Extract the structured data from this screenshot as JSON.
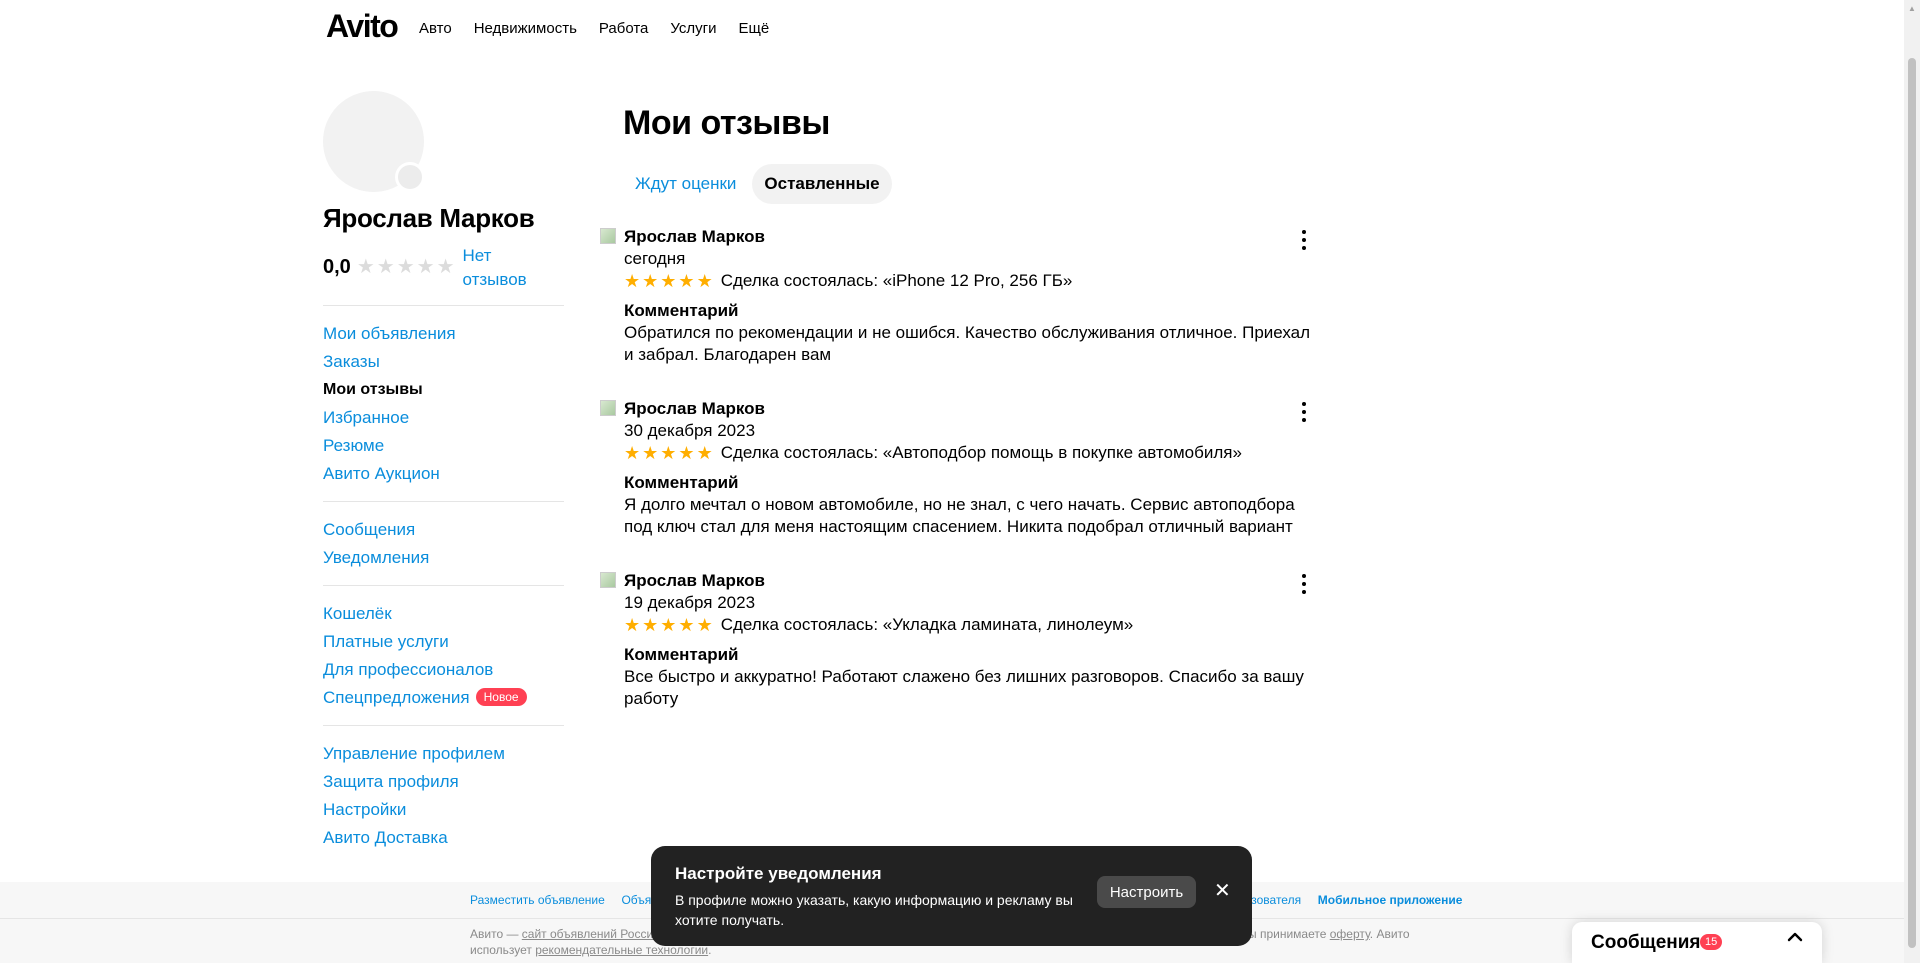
{
  "header": {
    "logo": "Avito",
    "nav": [
      "Авто",
      "Недвижимость",
      "Работа",
      "Услуги",
      "Ещё"
    ]
  },
  "profile": {
    "name": "Ярослав Марков",
    "rating": "0,0",
    "no_reviews_label": "Нет отзывов"
  },
  "sidebar": {
    "groups": [
      [
        {
          "label": "Мои объявления"
        },
        {
          "label": "Заказы"
        },
        {
          "label": "Мои отзывы",
          "active": true
        },
        {
          "label": "Избранное"
        },
        {
          "label": "Резюме"
        },
        {
          "label": "Авито Аукцион"
        }
      ],
      [
        {
          "label": "Сообщения"
        },
        {
          "label": "Уведомления"
        }
      ],
      [
        {
          "label": "Кошелёк"
        },
        {
          "label": "Платные услуги"
        },
        {
          "label": "Для профессионалов"
        },
        {
          "label": "Спецпредложения",
          "badge": "Новое"
        }
      ],
      [
        {
          "label": "Управление профилем"
        },
        {
          "label": "Защита профиля"
        },
        {
          "label": "Настройки"
        },
        {
          "label": "Авито Доставка"
        }
      ]
    ]
  },
  "main": {
    "title": "Мои отзывы",
    "tabs": [
      {
        "label": "Ждут оценки",
        "active": false
      },
      {
        "label": "Оставленные",
        "active": true
      }
    ],
    "comment_label": "Комментарий",
    "reviews": [
      {
        "author": "Ярослав Марков",
        "date": "сегодня",
        "stars": 5,
        "deal": "Сделка состоялась: «iPhone 12 Pro, 256 ГБ»",
        "comment": "Обратился по рекомендации и не ошибся. Качество обслуживания отличное. Приехал и забрал. Благодарен вам"
      },
      {
        "author": "Ярослав Марков",
        "date": "30 декабря 2023",
        "stars": 5,
        "deal": "Сделка состоялась: «Автоподбор помощь в покупке автомобиля»",
        "comment": "Я долго мечтал о новом автомобиле, но не знал, с чего начать. Сервис автоподбора под ключ стал для меня настоящим спасением. Никита подобрал отличный вариант"
      },
      {
        "author": "Ярослав Марков",
        "date": "19 декабря 2023",
        "stars": 5,
        "deal": "Сделка состоялась: «Укладка ламината, линолеум»",
        "comment": "Все быстро и аккуратно! Работают слажено без лишних разговоров. Спасибо за вашу работу"
      }
    ]
  },
  "footer": {
    "link_post_ad": "Разместить объявление",
    "link_partial": "Объяв",
    "link_partial_right": "льзователя",
    "link_mobile_app": "Мобильное приложение",
    "text_prefix": "Авито — ",
    "text_link": "сайт объявлений России",
    "text_suffix": ".",
    "text_line2_prefix": "использует ",
    "text_line2_link": "рекомендательные технологии",
    "text_line2_suffix": ".",
    "text_right_prefix": "ы принимаете ",
    "text_right_link": "оферту",
    "text_right_suffix": ". Авито"
  },
  "toast": {
    "title": "Настройте уведомления",
    "body": "В профиле можно указать, какую информацию и рекламу вы хотите получать.",
    "button": "Настроить",
    "close": "✕"
  },
  "messages_widget": {
    "label": "Сообщения",
    "count": "15"
  },
  "colors": {
    "link": "#0a8ddc",
    "star_active": "#ffae00",
    "star_inactive": "#dcdcdc",
    "badge": "#ff4053",
    "toast_bg": "#222222"
  }
}
